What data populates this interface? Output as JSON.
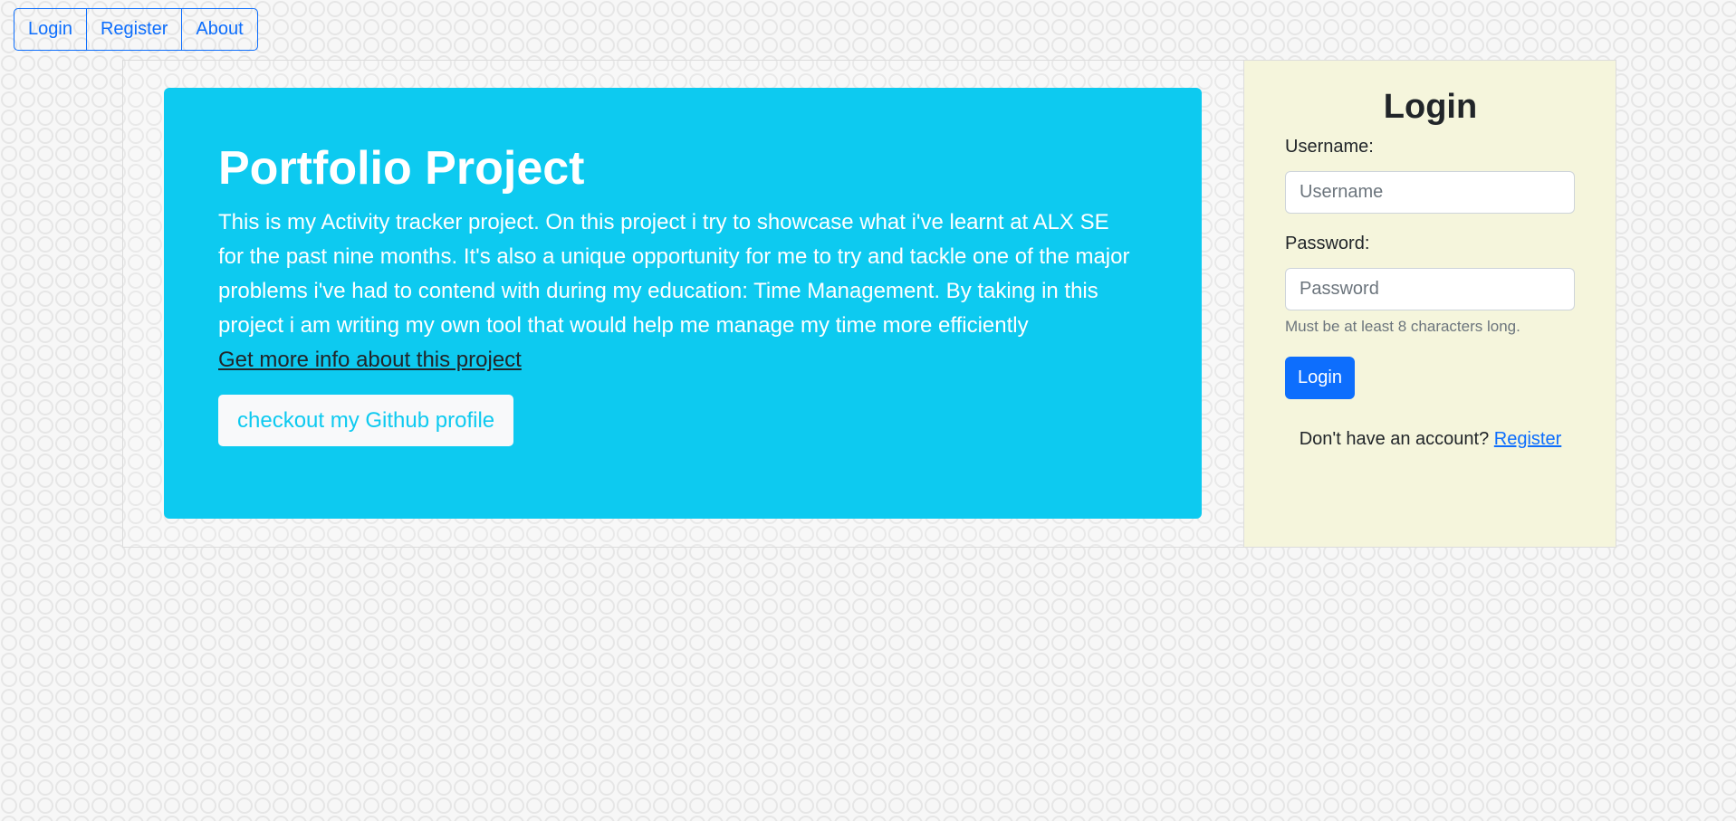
{
  "nav": {
    "items": [
      {
        "label": "Login"
      },
      {
        "label": "Register"
      },
      {
        "label": "About"
      }
    ]
  },
  "hero": {
    "title": "Portfolio Project",
    "description": "This is my Activity tracker project. On this project i try to showcase what i've learnt at ALX SE for the past nine months. It's also a unique opportunity for me to try and tackle one of the major problems i've had to contend with during my education: Time Management. By taking in this project i am writing my own tool that would help me manage my time more efficiently",
    "link_label": "Get more info about this project",
    "button_label": "checkout my Github profile"
  },
  "login": {
    "title": "Login",
    "username_label": "Username:",
    "username_placeholder": "Username",
    "password_label": "Password:",
    "password_placeholder": "Password",
    "password_help": "Must be at least 8 characters long.",
    "submit_label": "Login",
    "no_account_text": "Don't have an account?",
    "register_link": "Register"
  },
  "colors": {
    "hero_bg": "#0dcaf0",
    "primary": "#0d6efd",
    "login_panel_bg": "#f5f5dc",
    "page_bg": "#f7f7f7"
  }
}
